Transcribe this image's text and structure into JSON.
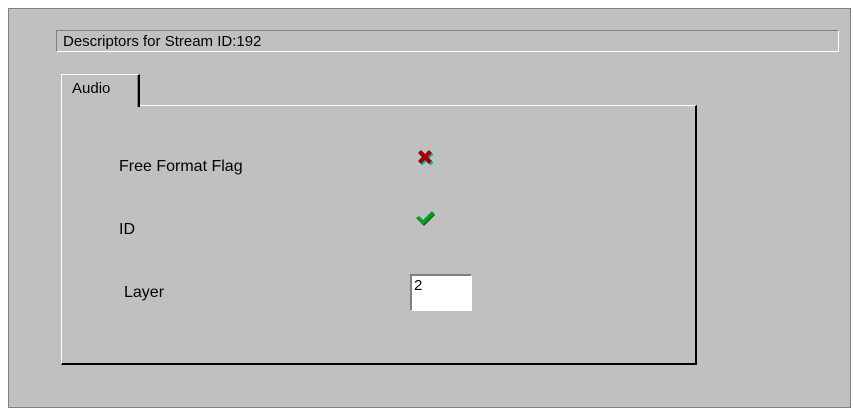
{
  "header": {
    "title": "Descriptors for Stream ID:192"
  },
  "tabs": [
    {
      "label": "Audio",
      "active": true
    }
  ],
  "fields": {
    "free_format_flag": {
      "label": "Free Format Flag",
      "state_icon": "cross-icon",
      "color": "#a00000"
    },
    "id": {
      "label": "ID",
      "state_icon": "check-icon",
      "color": "#00a020"
    },
    "layer": {
      "label": "Layer",
      "value": "2"
    }
  },
  "colors": {
    "window_bg": "#c0c0c0",
    "input_bg": "#ffffff"
  }
}
